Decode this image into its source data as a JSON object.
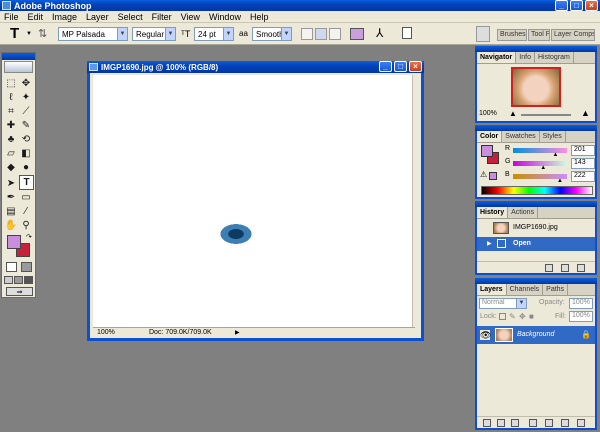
{
  "app": {
    "title": "Adobe Photoshop"
  },
  "menu": [
    "File",
    "Edit",
    "Image",
    "Layer",
    "Select",
    "Filter",
    "View",
    "Window",
    "Help"
  ],
  "options_bar": {
    "font_family": "MP Palsada",
    "font_style": "Regular",
    "font_size": "24 pt",
    "aa_label": "aa",
    "anti_alias": "Smooth",
    "tool_glyph": "T",
    "well_tabs": [
      "Brushes",
      "Tool Pr",
      "Layer Comps"
    ],
    "text_color": "#c9a0dc"
  },
  "document": {
    "title": "IMGP1690.jpg @ 100% (RGB/8)",
    "zoom": "100%",
    "doc_size": "Doc: 709.0K/709.0K"
  },
  "navigator": {
    "tabs": [
      "Navigator",
      "Info",
      "Histogram"
    ],
    "zoom": "100%"
  },
  "color": {
    "tabs": [
      "Color",
      "Swatches",
      "Styles"
    ],
    "r_label": "R",
    "g_label": "G",
    "b_label": "B",
    "r": "201",
    "g": "143",
    "b": "222",
    "fraction": {
      "r": 0.788,
      "g": 0.561,
      "b": 0.871
    },
    "foreground": "#c98fde",
    "background": "#c8203a"
  },
  "history": {
    "tabs": [
      "History",
      "Actions"
    ],
    "snapshot": "IMGP1690.jpg",
    "states": [
      "Open"
    ]
  },
  "layers": {
    "tabs": [
      "Layers",
      "Channels",
      "Paths"
    ],
    "blend_mode": "Normal",
    "opacity_label": "Opacity:",
    "opacity": "100%",
    "lock_label": "Lock:",
    "fill_label": "Fill:",
    "fill": "100%",
    "items": [
      {
        "name": "Background"
      }
    ]
  }
}
